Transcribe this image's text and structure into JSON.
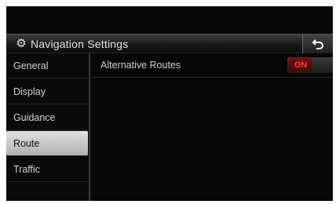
{
  "header": {
    "title": "Navigation Settings",
    "icon": "gear-icon",
    "back_icon": "back-arrow-icon"
  },
  "sidebar": {
    "items": [
      {
        "label": "General",
        "active": false
      },
      {
        "label": "Display",
        "active": false
      },
      {
        "label": "Guidance",
        "active": false
      },
      {
        "label": "Route",
        "active": true
      },
      {
        "label": "Traffic",
        "active": false
      }
    ]
  },
  "main": {
    "settings": [
      {
        "label": "Alternative Routes",
        "value": "ON"
      }
    ]
  },
  "colors": {
    "accent_on": "#ff3a3a",
    "active_tab": "#c8c8c8"
  }
}
